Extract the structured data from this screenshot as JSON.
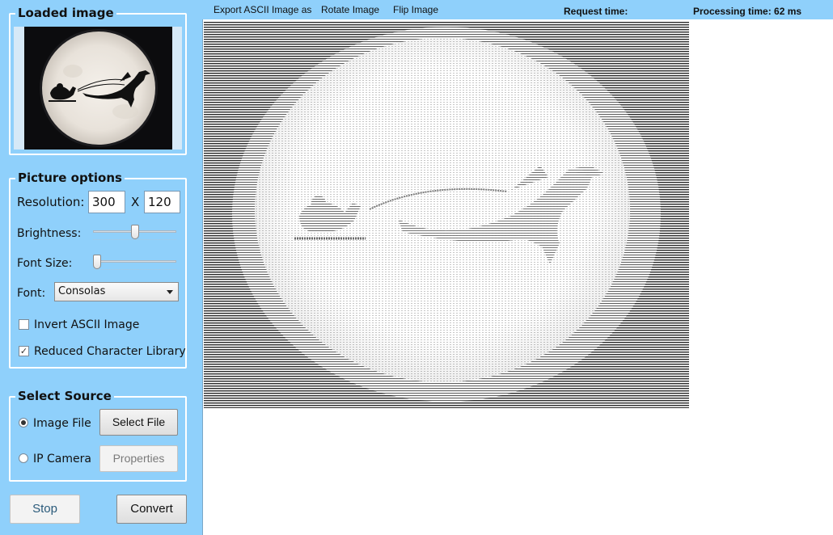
{
  "loaded_image": {
    "title": "Loaded image"
  },
  "picture_options": {
    "title": "Picture options",
    "resolution_label": "Resolution:",
    "resolution_width": "300",
    "resolution_separator": "X",
    "resolution_height": "120",
    "brightness_label": "Brightness:",
    "brightness_level": 0.5,
    "font_size_label": "Font Size:",
    "font_size_level": 0.0,
    "font_label": "Font:",
    "font_value": "Consolas",
    "invert_label": "Invert ASCII Image",
    "invert_checked": false,
    "reduced_label": "Reduced Character Library",
    "reduced_checked": true
  },
  "select_source": {
    "title": "Select Source",
    "image_file_label": "Image File",
    "image_file_selected": true,
    "select_file_button": "Select File",
    "ip_camera_label": "IP Camera",
    "ip_camera_selected": false,
    "properties_button": "Properties"
  },
  "actions": {
    "stop_button": "Stop",
    "convert_button": "Convert"
  },
  "toolbar": {
    "export_label": "Export ASCII Image as",
    "rotate_label": "Rotate Image",
    "flip_label": "Flip Image",
    "request_time_label": "Request time:",
    "processing_time_label": "Processing time: 62 ms"
  },
  "colors": {
    "panel_background": "#8fd0fb",
    "group_border": "#ffffff",
    "output_background": "#ffffff",
    "ascii_dark": "#2a2a2a"
  },
  "icons": {
    "combo_arrow": "chevron-down-icon",
    "checkbox_mark": "checkmark-icon"
  }
}
